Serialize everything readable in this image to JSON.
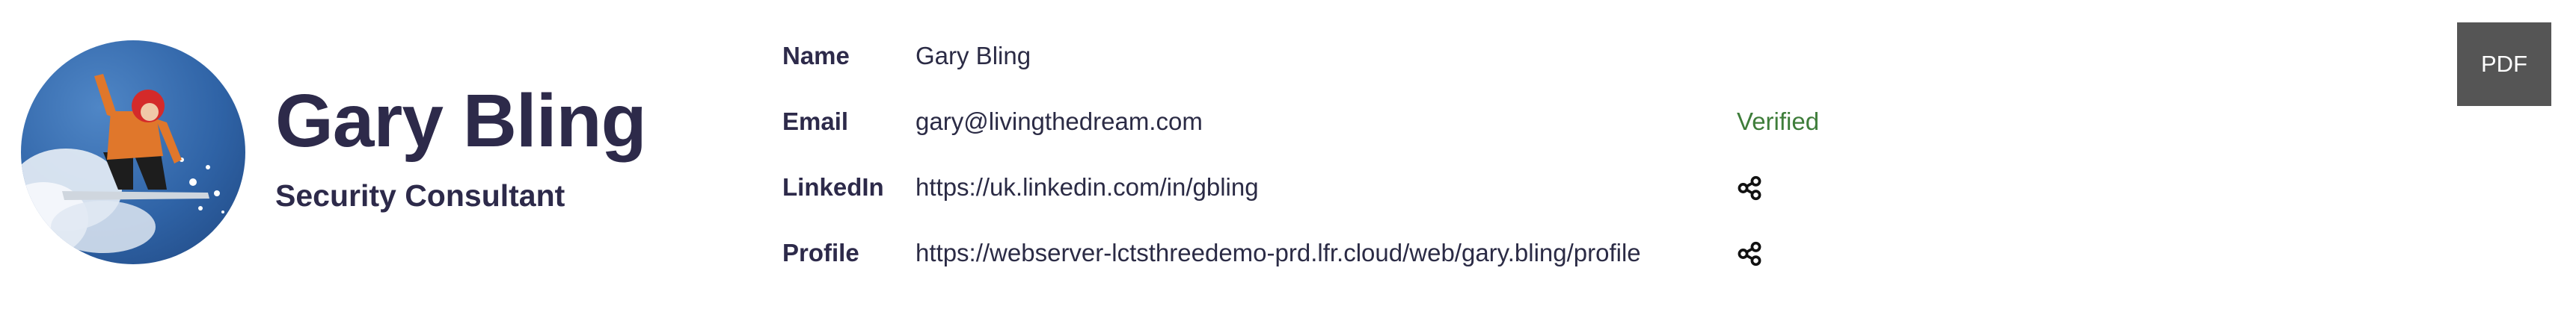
{
  "profile": {
    "full_name": "Gary Bling",
    "job_title": "Security Consultant",
    "avatar_icon": "snowboarder-photo"
  },
  "fields": {
    "name": {
      "label": "Name",
      "value": "Gary Bling"
    },
    "email": {
      "label": "Email",
      "value": "gary@livingthedream.com",
      "status": "Verified"
    },
    "linkedin": {
      "label": "LinkedIn",
      "value": "https://uk.linkedin.com/in/gbling",
      "action_icon": "share-icon"
    },
    "profile": {
      "label": "Profile",
      "value": "https://webserver-lctsthreedemo-prd.lfr.cloud/web/gary.bling/profile",
      "action_icon": "share-icon"
    }
  },
  "actions": {
    "pdf_label": "PDF"
  },
  "colors": {
    "heading": "#2d2a4a",
    "verified": "#3e7d3a",
    "pdf_button": "#555555",
    "avatar_sky": "#3f6fb2"
  }
}
